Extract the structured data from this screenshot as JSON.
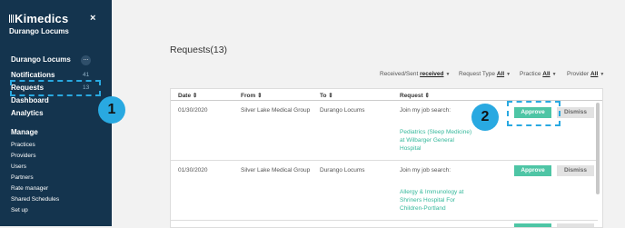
{
  "sidebar": {
    "brand": "Kimedics",
    "org": "Durango Locums",
    "account": "Durango Locums",
    "account_menu": "...",
    "notifications": {
      "label": "Notifications",
      "count": "41"
    },
    "requests": {
      "label": "Requests",
      "count": "13"
    },
    "dashboard": "Dashboard",
    "analytics": "Analytics",
    "manage": "Manage",
    "items": [
      "Practices",
      "Providers",
      "Users",
      "Partners",
      "Rate manager",
      "Shared Schedules",
      "Set up"
    ]
  },
  "callouts": [
    "1",
    "2"
  ],
  "page": {
    "title": "Requests(13)"
  },
  "filters": [
    {
      "label": "Received/Sent",
      "value": "received"
    },
    {
      "label": "Request Type",
      "value": "All"
    },
    {
      "label": "Practice",
      "value": "All"
    },
    {
      "label": "Provider",
      "value": "All"
    }
  ],
  "table": {
    "headers": [
      "Date",
      "From",
      "To",
      "Request"
    ],
    "rows": [
      {
        "date": "01/30/2020",
        "from": "Silver Lake Medical Group",
        "to": "Durango Locums",
        "request": "Join my job search:",
        "link": "Pediatrics (Sleep Medicine) at Wilbarger General Hospital",
        "approve": "Approve",
        "dismiss": "Dismiss"
      },
      {
        "date": "01/30/2020",
        "from": "Silver Lake Medical Group",
        "to": "Durango Locums",
        "request": "Join my job search:",
        "link": "Allergy & Immunology at Shriners Hospital For Children-Portland",
        "approve": "Approve",
        "dismiss": "Dismiss"
      }
    ]
  }
}
